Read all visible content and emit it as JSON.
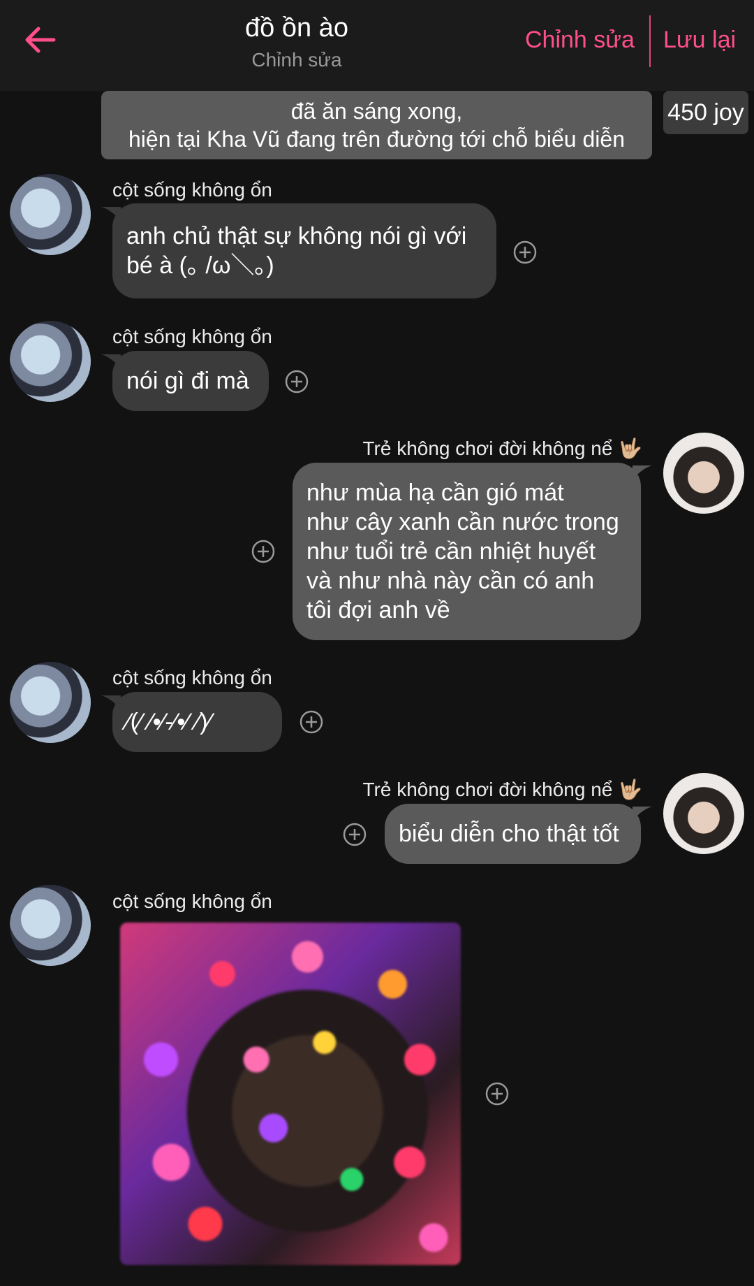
{
  "header": {
    "title": "đồ ồn ào",
    "subtitle": "Chỉnh sửa",
    "edit_label": "Chỉnh sửa",
    "save_label": "Lưu lại"
  },
  "system": {
    "banner_line1": "đã ăn sáng xong,",
    "banner_line2": "hiện tại Kha Vũ đang trên đường tới chỗ biểu diễn",
    "joy": "450 joy"
  },
  "messages": [
    {
      "sender": "cột sống không ổn",
      "lines": [
        "anh chủ thật sự không nói gì với",
        "bé à (｡ /ω＼｡)"
      ]
    },
    {
      "sender": "cột sống không ổn",
      "lines": [
        "nói gì đi mà"
      ]
    },
    {
      "sender": "Trẻ không chơi đời không nể 🤟🏼",
      "lines": [
        "như mùa hạ cần gió mát",
        "như cây xanh cần nước trong",
        "như tuổi trẻ cần nhiệt huyết",
        "và như nhà này cần có anh",
        "tôi đợi anh về"
      ]
    },
    {
      "sender": "cột sống không ổn",
      "lines": [
        "⁄(⁄ ⁄•⁄-⁄•⁄ ⁄)⁄"
      ]
    },
    {
      "sender": "Trẻ không chơi đời không nể 🤟🏼",
      "lines": [
        "biểu diễn cho thật tốt"
      ]
    },
    {
      "sender": "cột sống không ổn",
      "type": "image"
    }
  ],
  "colors": {
    "accent": "#ff4f8b",
    "background": "#121212",
    "header_bg": "#1b1b1b",
    "bubble_other": "#3b3b3b",
    "bubble_mine": "#5a5a5a",
    "banner_bg": "#5b5b5b"
  }
}
